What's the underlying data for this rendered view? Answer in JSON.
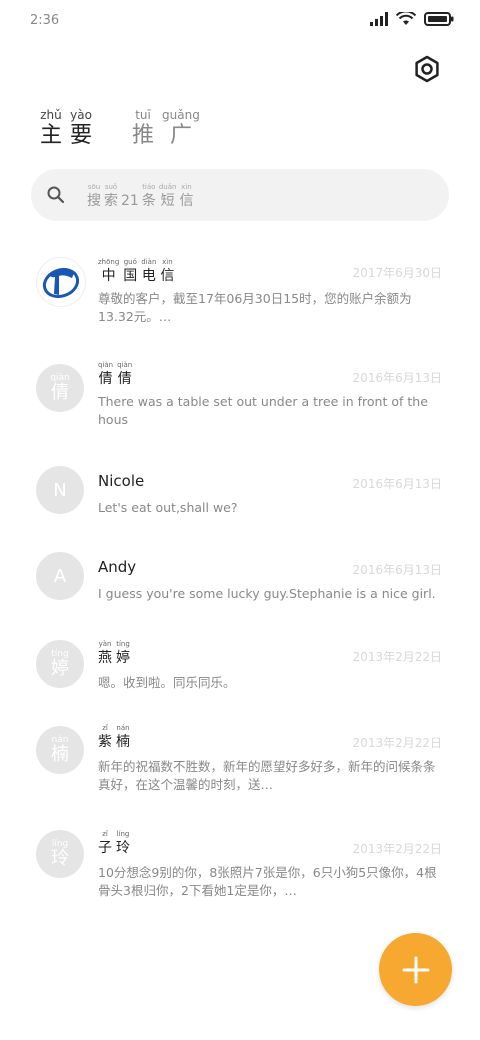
{
  "status_bar": {
    "time": "2:36"
  },
  "tabs": [
    {
      "name": "main",
      "chars": [
        {
          "py": "zhǔ",
          "hz": "主"
        },
        {
          "py": "yào",
          "hz": "要"
        }
      ]
    },
    {
      "name": "promo",
      "chars": [
        {
          "py": "tuī",
          "hz": "推"
        },
        {
          "py": "guǎng",
          "hz": "广"
        }
      ]
    }
  ],
  "search": {
    "pre": [
      {
        "py": "sōu",
        "hz": "搜"
      },
      {
        "py": "suǒ",
        "hz": "索"
      }
    ],
    "count": "21",
    "post": [
      {
        "py": "tiáo",
        "hz": "条"
      },
      {
        "py": "duǎn",
        "hz": "短"
      },
      {
        "py": "xìn",
        "hz": "信"
      }
    ]
  },
  "conversations": [
    {
      "name_chars": [
        {
          "py": "zhōng",
          "hz": "中"
        },
        {
          "py": "guó",
          "hz": "国"
        },
        {
          "py": "diàn",
          "hz": "电"
        },
        {
          "py": "xìn",
          "hz": "信"
        }
      ],
      "date": "2017年6月30日",
      "message": "尊敬的客户，截至17年06月30日15时，您的账户余额为13.32元。…"
    },
    {
      "avatar_py": "qiàn",
      "avatar_hz": "倩",
      "name_chars": [
        {
          "py": "qiàn",
          "hz": "倩"
        },
        {
          "py": "qiàn",
          "hz": "倩"
        }
      ],
      "date": "2016年6月13日",
      "message": "There was a table set out under a tree in front of the hous"
    },
    {
      "avatar_letter": "N",
      "name": "Nicole",
      "date": "2016年6月13日",
      "message": "Let's eat out,shall we?"
    },
    {
      "avatar_letter": "A",
      "name": "Andy",
      "date": "2016年6月13日",
      "message": "I guess you're some lucky guy.Stephanie is a nice girl."
    },
    {
      "avatar_py": "tíng",
      "avatar_hz": "婷",
      "name_chars": [
        {
          "py": "yàn",
          "hz": "燕"
        },
        {
          "py": "tíng",
          "hz": "婷"
        }
      ],
      "date": "2013年2月22日",
      "message": "嗯。收到啦。同乐同乐。"
    },
    {
      "avatar_py": "nán",
      "avatar_hz": "楠",
      "name_chars": [
        {
          "py": "zǐ",
          "hz": "紫"
        },
        {
          "py": "nán",
          "hz": "楠"
        }
      ],
      "date": "2013年2月22日",
      "message": "新年的祝福数不胜数，新年的愿望好多好多，新年的问候条条真好，在这个温馨的时刻，送…"
    },
    {
      "avatar_py": "líng",
      "avatar_hz": "玲",
      "name_chars": [
        {
          "py": "zǐ",
          "hz": "子"
        },
        {
          "py": "líng",
          "hz": "玲"
        }
      ],
      "date": "2013年2月22日",
      "message": "10分想念9别的你，8张照片7张是你，6只小狗5只像你，4根骨头3根归你，2下看她1定是你，…"
    }
  ],
  "colors": {
    "accent": "#f7a830",
    "search_bg": "#f2f2f2",
    "avatar_bg": "#e5e5e5",
    "date": "#d8d8d8"
  }
}
